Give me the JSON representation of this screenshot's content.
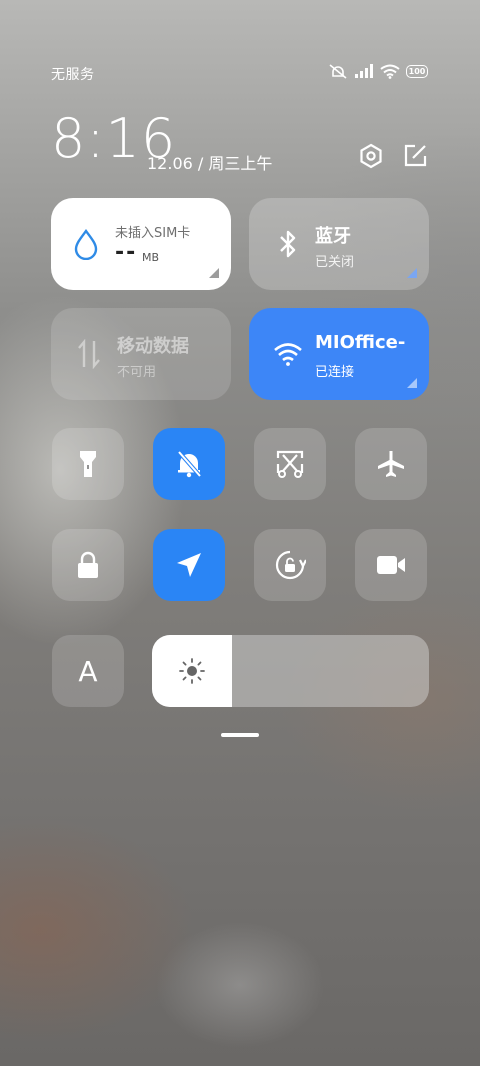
{
  "status_bar": {
    "carrier": "无服务",
    "battery": "100",
    "icons": [
      "mute-vibrate-icon",
      "signal-icon",
      "wifi-icon",
      "battery-icon"
    ]
  },
  "header": {
    "time": "8:16",
    "date": "12.06 / 周三上午",
    "icons": [
      "settings-icon",
      "edit-icon"
    ]
  },
  "tiles": {
    "data_usage": {
      "title": "未插入SIM卡",
      "value": "--",
      "unit": "MB",
      "icon": "water-drop-icon"
    },
    "bluetooth": {
      "title": "蓝牙",
      "status": "已关闭",
      "icon": "bluetooth-icon"
    },
    "mobile_data": {
      "title": "移动数据",
      "status": "不可用",
      "icon": "data-arrows-icon"
    },
    "wifi": {
      "title": "MIOffice-",
      "status": "已连接",
      "icon": "wifi-icon",
      "accent": "#3d86f7"
    }
  },
  "toggles": [
    {
      "name": "flashlight",
      "icon": "flashlight-icon",
      "active": false
    },
    {
      "name": "mute",
      "icon": "bell-off-icon",
      "active": true
    },
    {
      "name": "screenshot",
      "icon": "scissors-icon",
      "active": false
    },
    {
      "name": "airplane",
      "icon": "airplane-icon",
      "active": false
    },
    {
      "name": "lock",
      "icon": "lock-icon",
      "active": false
    },
    {
      "name": "location",
      "icon": "location-arrow-icon",
      "active": true
    },
    {
      "name": "rotation-lock",
      "icon": "rotation-lock-icon",
      "active": false
    },
    {
      "name": "screen-record",
      "icon": "video-camera-icon",
      "active": false
    }
  ],
  "bottom": {
    "font_label": "A",
    "brightness_level": 0.29,
    "icon": "sun-icon"
  },
  "colors": {
    "active": "#2a85f5",
    "drop": "#2f8be6"
  }
}
